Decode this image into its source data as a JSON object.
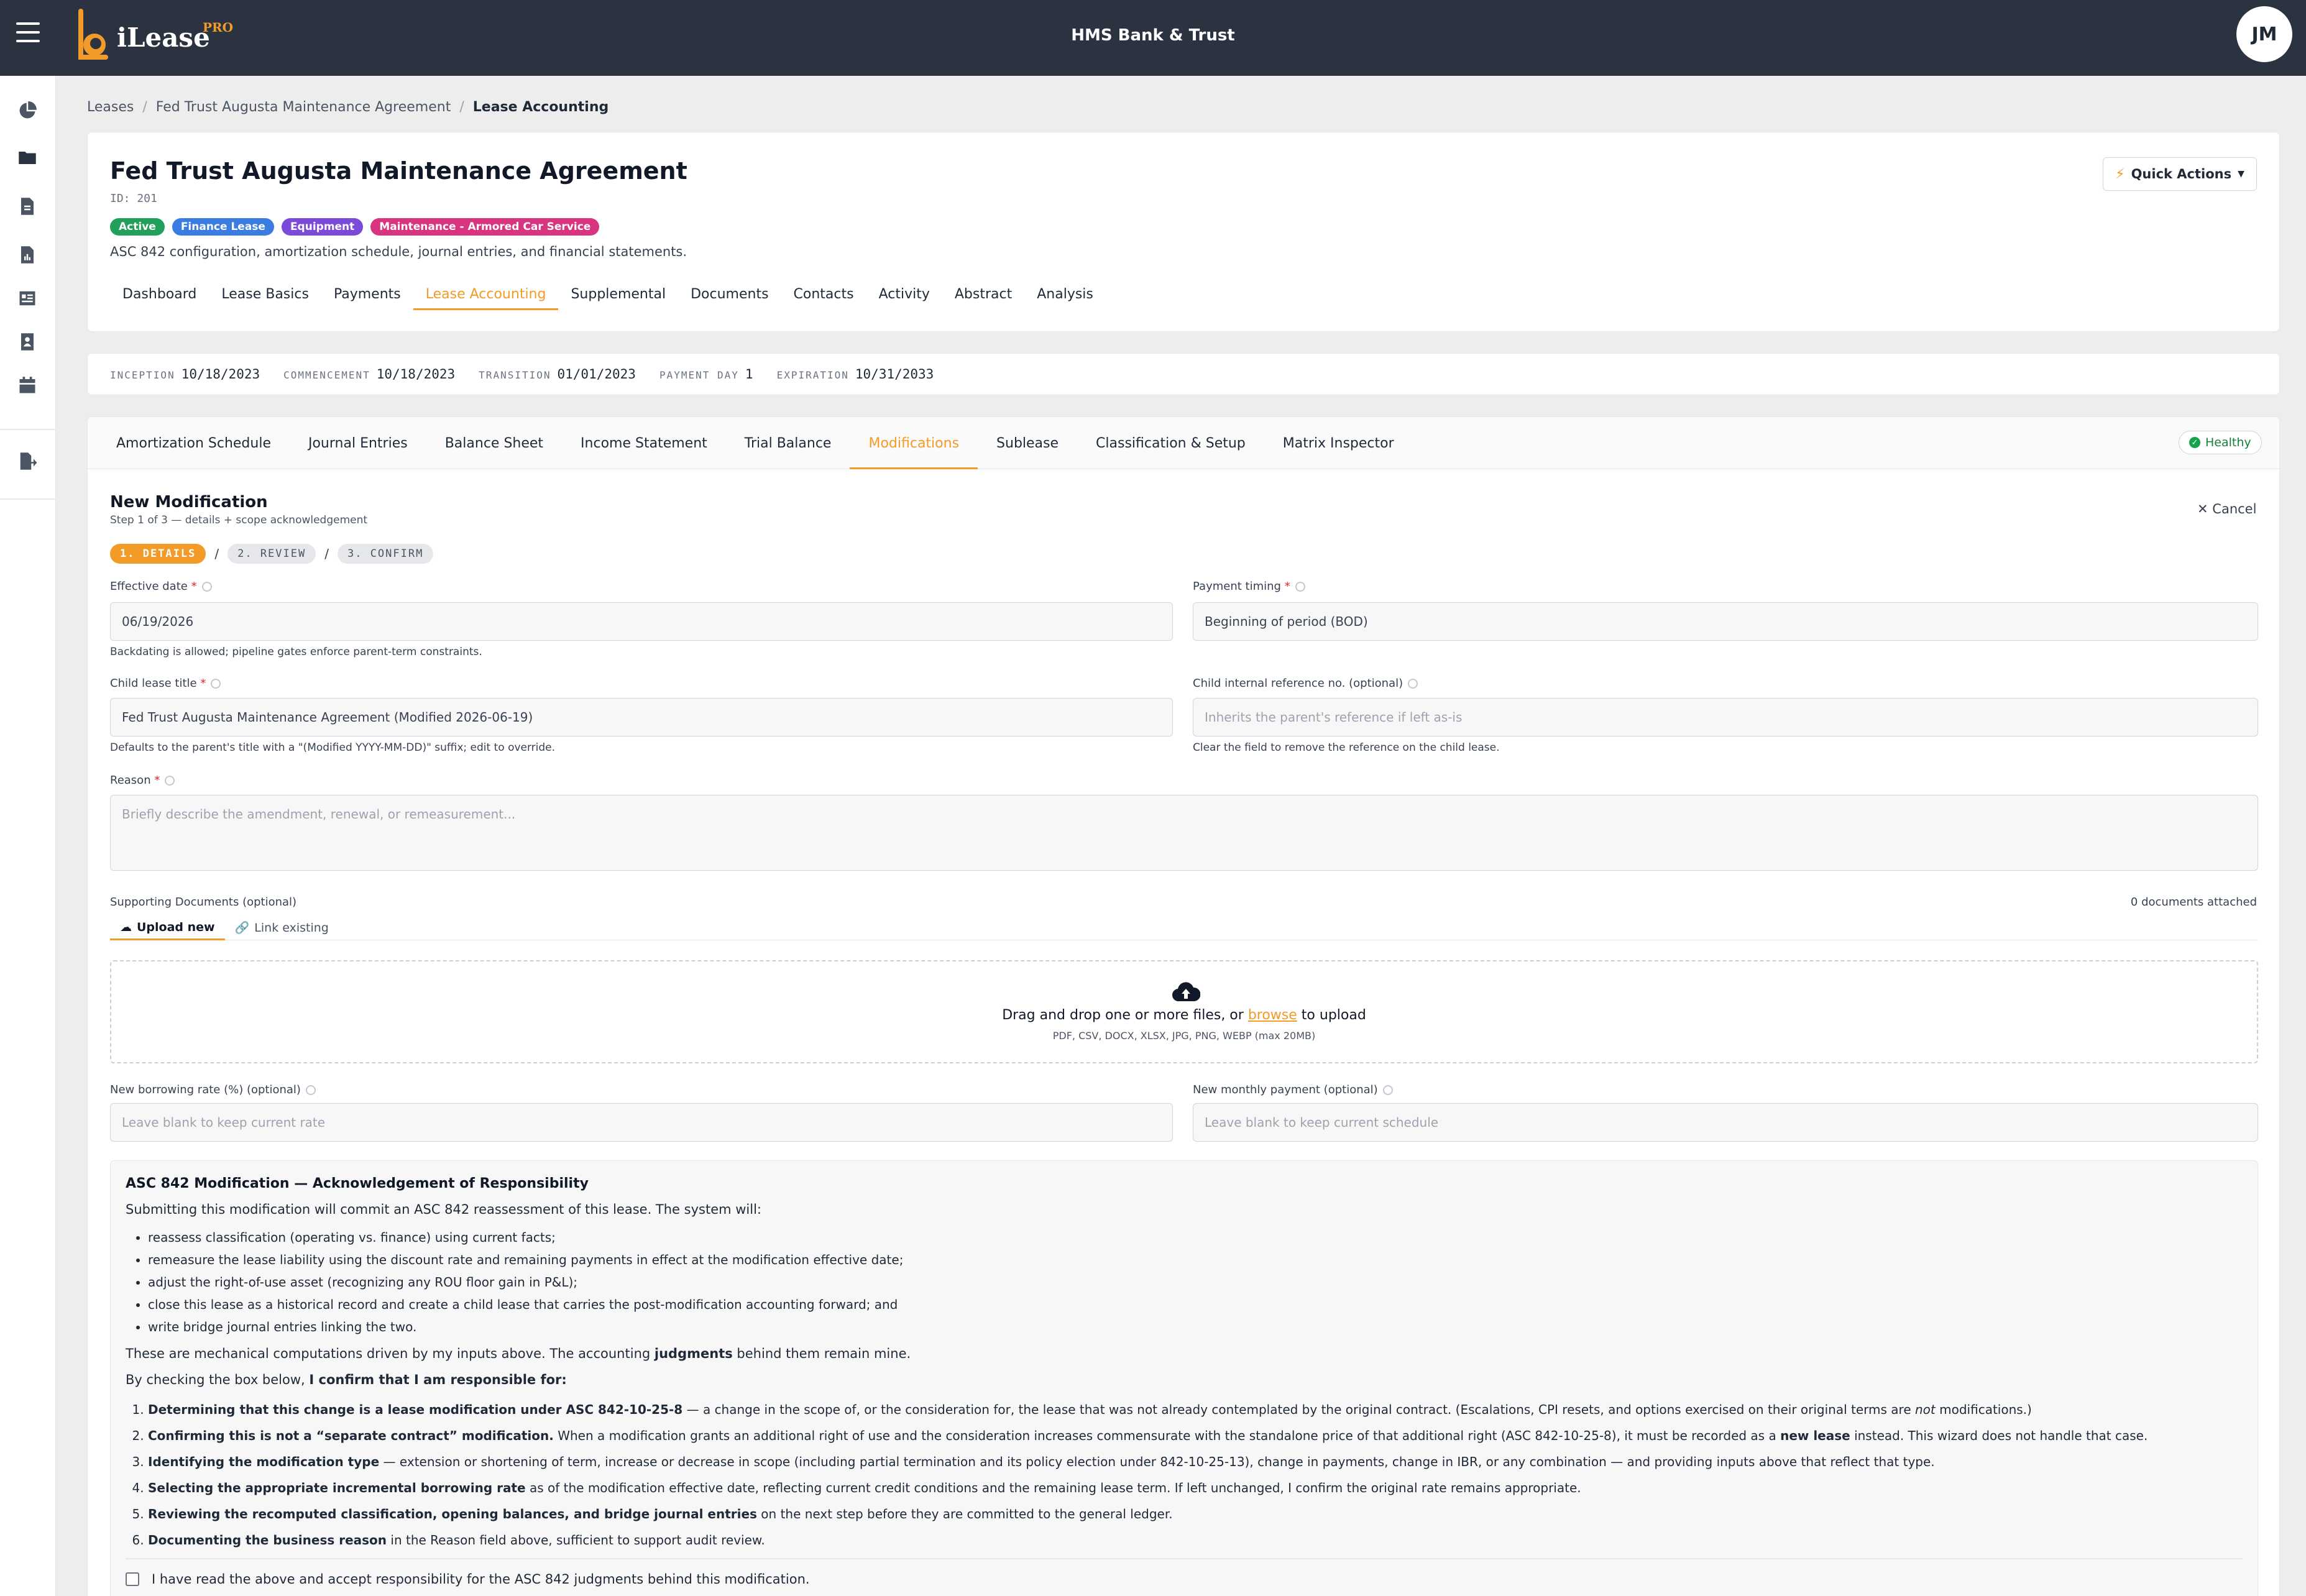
{
  "app": {
    "brand": "iLease",
    "brand_badge": "PRO",
    "bank": "HMS Bank & Trust",
    "user_initials": "JM"
  },
  "breadcrumb": [
    "Leases",
    "Fed Trust Augusta Maintenance Agreement",
    "Lease Accounting"
  ],
  "lease": {
    "title": "Fed Trust Augusta Maintenance Agreement",
    "id_label": "ID: 201",
    "tags": [
      {
        "label": "Active",
        "color": "#22a05a"
      },
      {
        "label": "Finance Lease",
        "color": "#3b7ce0"
      },
      {
        "label": "Equipment",
        "color": "#7c4ad9"
      },
      {
        "label": "Maintenance - Armored Car Service",
        "color": "#d9347f"
      }
    ],
    "description": "ASC 842 configuration, amortization schedule, journal entries, and financial statements.",
    "quick_actions": "Quick Actions"
  },
  "main_tabs": [
    "Dashboard",
    "Lease Basics",
    "Payments",
    "Lease Accounting",
    "Supplemental",
    "Documents",
    "Contacts",
    "Activity",
    "Abstract",
    "Analysis"
  ],
  "active_main_tab": "Lease Accounting",
  "dates": [
    {
      "label": "INCEPTION",
      "value": "10/18/2023"
    },
    {
      "label": "COMMENCEMENT",
      "value": "10/18/2023"
    },
    {
      "label": "TRANSITION",
      "value": "01/01/2023"
    },
    {
      "label": "PAYMENT DAY",
      "value": "1"
    },
    {
      "label": "EXPIRATION",
      "value": "10/31/2033"
    }
  ],
  "sub_tabs": [
    "Amortization Schedule",
    "Journal Entries",
    "Balance Sheet",
    "Income Statement",
    "Trial Balance",
    "Modifications",
    "Sublease",
    "Classification & Setup",
    "Matrix Inspector"
  ],
  "active_sub_tab": "Modifications",
  "status": "Healthy",
  "form": {
    "title": "New Modification",
    "step_text": "Step 1 of 3 — details + scope acknowledgement",
    "cancel": "Cancel",
    "steps": [
      "1. DETAILS",
      "2. REVIEW",
      "3. CONFIRM"
    ],
    "effective_date": {
      "label": "Effective date",
      "value": "06/19/2026",
      "help": "Backdating is allowed; pipeline gates enforce parent-term constraints."
    },
    "payment_timing": {
      "label": "Payment timing",
      "value": "Beginning of period (BOD)"
    },
    "child_title": {
      "label": "Child lease title",
      "value": "Fed Trust Augusta Maintenance Agreement (Modified 2026-06-19)",
      "help": "Defaults to the parent's title with a \"(Modified YYYY-MM-DD)\" suffix; edit to override."
    },
    "child_ref": {
      "label": "Child internal reference no. (optional)",
      "placeholder": "Inherits the parent's reference if left as-is",
      "help": "Clear the field to remove the reference on the child lease."
    },
    "reason": {
      "label": "Reason",
      "placeholder": "Briefly describe the amendment, renewal, or remeasurement..."
    },
    "supporting": {
      "label": "Supporting Documents (optional)",
      "count": "0 documents attached",
      "tab_upload": "Upload new",
      "tab_link": "Link existing",
      "drop_pre": "Drag and drop one or more files, or",
      "browse": "browse",
      "drop_post": "to upload",
      "formats": "PDF, CSV, DOCX, XLSX, JPG, PNG, WEBP (max 20MB)"
    },
    "borrowing_rate": {
      "label": "New borrowing rate (%) (optional)",
      "placeholder": "Leave blank to keep current rate"
    },
    "monthly_payment": {
      "label": "New monthly payment (optional)",
      "placeholder": "Leave blank to keep current schedule"
    }
  },
  "ack": {
    "title": "ASC 842 Modification — Acknowledgement of Responsibility",
    "intro": "Submitting this modification will commit an ASC 842 reassessment of this lease. The system will:",
    "bullets": [
      "reassess classification (operating vs. finance) using current facts;",
      "remeasure the lease liability using the discount rate and remaining payments in effect at the modification effective date;",
      "adjust the right-of-use asset (recognizing any ROU floor gain in P&L);",
      "close this lease as a historical record and create a child lease that carries the post-modification accounting forward; and",
      "write bridge journal entries linking the two."
    ],
    "mech_pre": "These are mechanical computations driven by my inputs above. The accounting",
    "mech_bold": "judgments",
    "mech_post": "behind them remain mine.",
    "confirm_pre": "By checking the box below,",
    "confirm_bold": "I confirm that I am responsible for:",
    "items": [
      {
        "bold": "Determining that this change is a lease modification under ASC 842-10-25-8",
        "text": " — a change in the scope of, or the consideration for, the lease that was not already contemplated by the original contract. (Escalations, CPI resets, and options exercised on their original terms are ",
        "italic": "not",
        "tail": " modifications.)"
      },
      {
        "bold": "Confirming this is not a “separate contract” modification.",
        "text": " When a modification grants an additional right of use and the consideration increases commensurate with the standalone price of that additional right (ASC 842-10-25-8), it must be recorded as a ",
        "bold2": "new lease",
        "tail": " instead. This wizard does not handle that case."
      },
      {
        "bold": "Identifying the modification type",
        "text": " — extension or shortening of term, increase or decrease in scope (including partial termination and its policy election under 842-10-25-13), change in payments, change in IBR, or any combination — and providing inputs above that reflect that type."
      },
      {
        "bold": "Selecting the appropriate incremental borrowing rate",
        "text": " as of the modification effective date, reflecting current credit conditions and the remaining lease term. If left unchanged, I confirm the original rate remains appropriate."
      },
      {
        "bold": "Reviewing the recomputed classification, opening balances, and bridge journal entries",
        "text": " on the next step before they are committed to the general ledger."
      },
      {
        "bold": "Documenting the business reason",
        "text": " in the Reason field above, sufficient to support audit review."
      }
    ],
    "checkbox_label": "I have read the above and accept responsibility for the ASC 842 judgments behind this modification."
  },
  "sidebar_icons": [
    "pie-chart-icon",
    "folder-icon",
    "document-icon",
    "report-icon",
    "ledger-icon",
    "contacts-icon",
    "calendar-icon",
    "file-export-icon"
  ]
}
